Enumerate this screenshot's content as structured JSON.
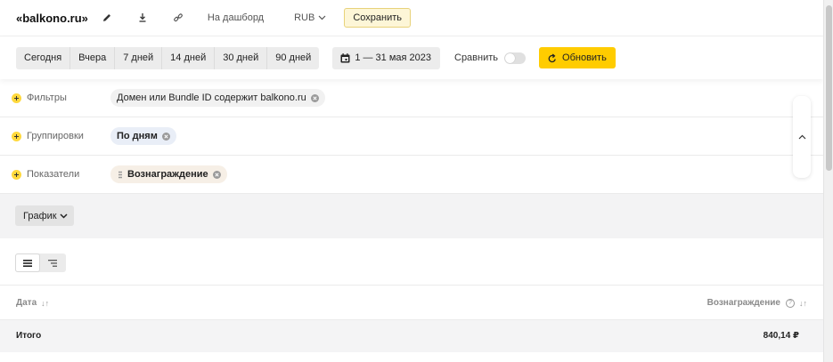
{
  "header": {
    "title": "«balkono.ru»",
    "dashboard_label": "На дашборд",
    "currency": "RUB",
    "save_label": "Сохранить"
  },
  "toolbar": {
    "periods": [
      "Сегодня",
      "Вчера",
      "7 дней",
      "14 дней",
      "30 дней",
      "90 дней"
    ],
    "date_range": "1 — 31 мая 2023",
    "compare_label": "Сравнить",
    "compare_enabled": false,
    "refresh_label": "Обновить"
  },
  "config": {
    "filters": {
      "label": "Фильтры",
      "chip": "Домен или Bundle ID содержит balkono.ru"
    },
    "groupings": {
      "label": "Группировки",
      "chip": "По дням"
    },
    "metrics": {
      "label": "Показатели",
      "chip": "Вознаграждение"
    }
  },
  "chart": {
    "button_label": "График"
  },
  "table": {
    "columns": [
      "Дата",
      "Вознаграждение"
    ],
    "total_label": "Итого",
    "total_value": "840,14 ₽"
  },
  "colors": {
    "accent": "#ffcc00",
    "save_bg": "#fdf6d7",
    "chip_blue": "#e9eef7",
    "chip_beige": "#f6efe6"
  },
  "icons": [
    "pencil-icon",
    "download-icon",
    "link-icon",
    "chevron-down-icon",
    "calendar-icon",
    "refresh-icon",
    "plus-icon",
    "close-icon",
    "drag-handle-icon",
    "chevron-up-icon",
    "table-view-icon",
    "tree-view-icon",
    "sort-icon",
    "help-icon"
  ]
}
